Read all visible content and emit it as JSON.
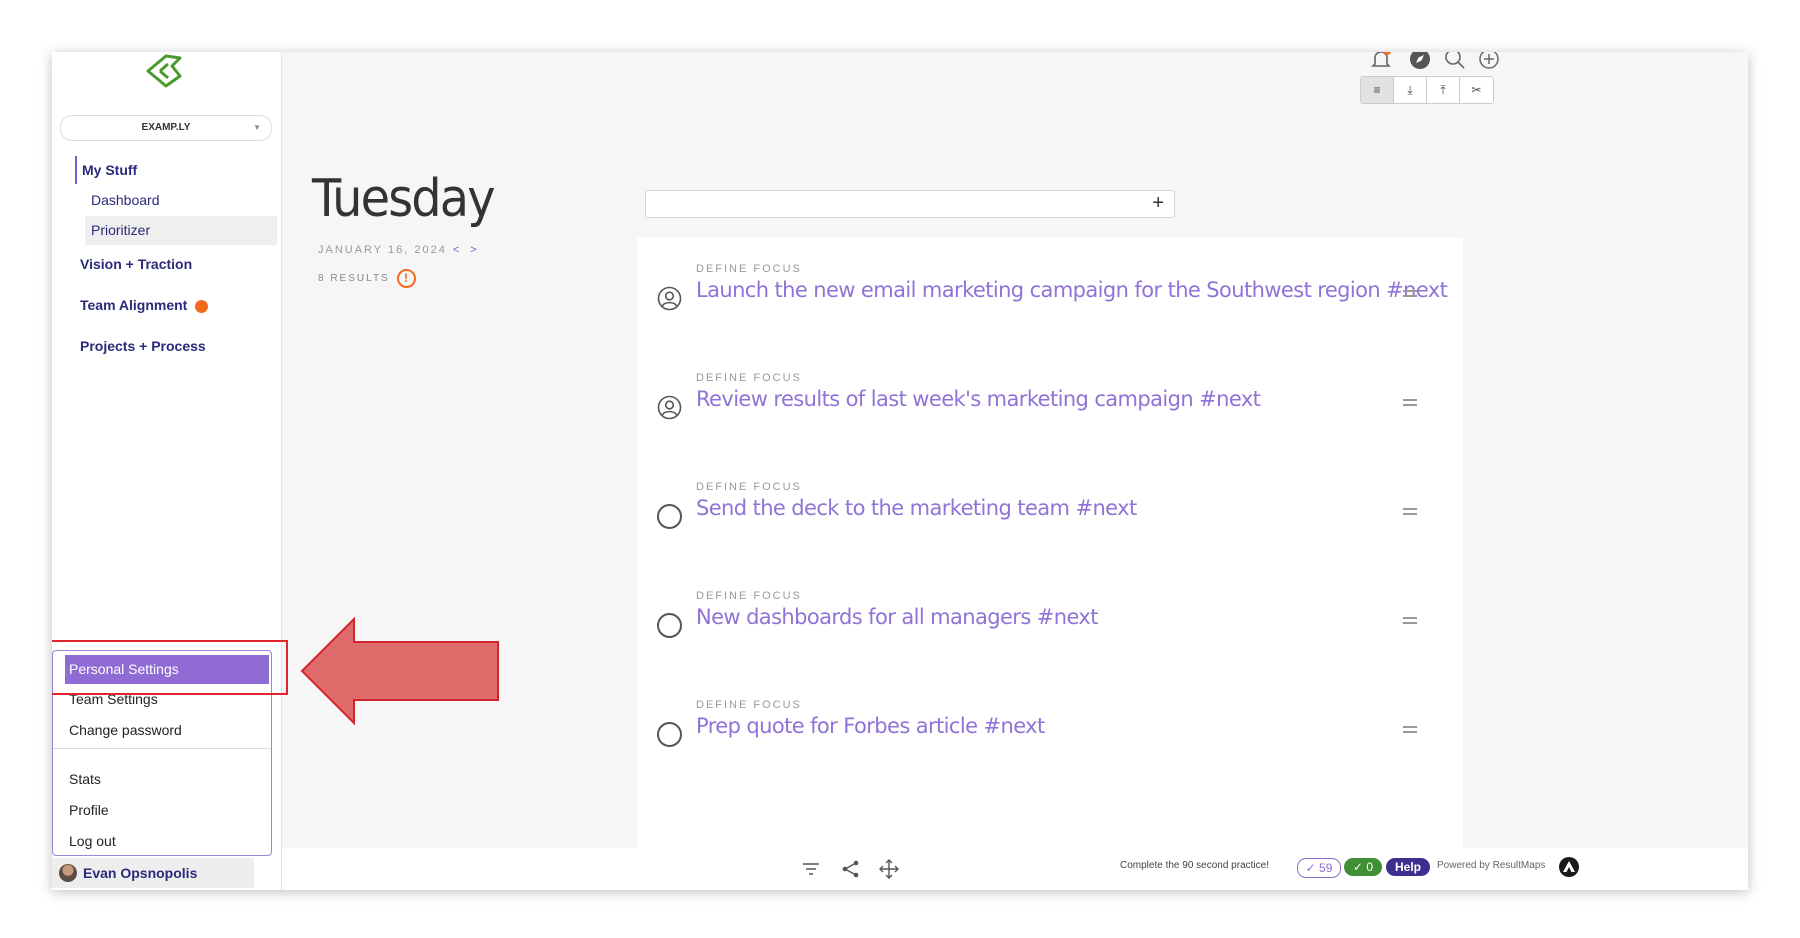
{
  "workspace": {
    "name": "EXAMP.LY"
  },
  "sidebar": {
    "sections": [
      {
        "label": "My Stuff",
        "items": [
          "Dashboard",
          "Prioritizer"
        ]
      },
      {
        "label": "Vision + Traction"
      },
      {
        "label": "Team Alignment"
      },
      {
        "label": "Projects + Process"
      }
    ],
    "active_item": "Prioritizer"
  },
  "user_menu": {
    "items": [
      "Personal Settings",
      "Team Settings",
      "Change password",
      "Stats",
      "Profile",
      "Log out"
    ],
    "highlighted": "Personal Settings"
  },
  "user": {
    "name": "Evan Opsnopolis"
  },
  "header": {
    "day": "Tuesday",
    "date": "JANUARY 16, 2024",
    "date_nav": "< >",
    "results": "8 RESULTS",
    "warning_icon": "!"
  },
  "add_task": {
    "plus_label": "+"
  },
  "tasks": [
    {
      "category": "DEFINE FOCUS",
      "title": "Launch the new email marketing campaign for the Southwest region #next",
      "icon": "person-circle-icon"
    },
    {
      "category": "DEFINE FOCUS",
      "title": "Review results of last week's marketing campaign #next",
      "icon": "person-circle-icon"
    },
    {
      "category": "DEFINE FOCUS",
      "title": "Send the deck to the marketing team #next",
      "icon": "empty-circle-icon"
    },
    {
      "category": "DEFINE FOCUS",
      "title": "New dashboards for all managers #next",
      "icon": "empty-circle-icon"
    },
    {
      "category": "DEFINE FOCUS",
      "title": "Prep quote for Forbes article #next",
      "icon": "empty-circle-icon"
    }
  ],
  "view_tabs": [
    "≡",
    "⤓",
    "⤒",
    "✂"
  ],
  "footer": {
    "practice_text": "Complete the 90 second practice!",
    "count_pending": "✓ 59",
    "count_done": "✓ 0",
    "help_label": "Help",
    "powered_text": "Powered by ResultMaps"
  },
  "colors": {
    "accent": "#8f6bd3",
    "nav_text": "#2b2a7a",
    "alert": "#f26b1d",
    "annotation": "#e2242e"
  }
}
